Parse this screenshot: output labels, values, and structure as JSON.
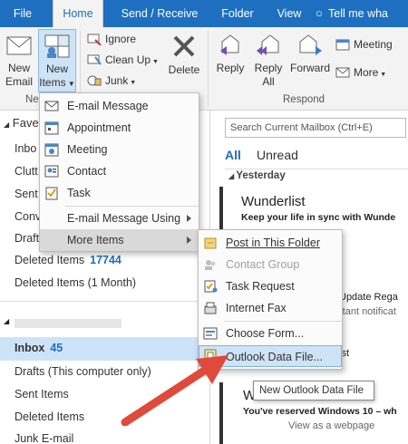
{
  "tabs": [
    "File",
    "Home",
    "Send / Receive",
    "Folder",
    "View",
    "Tell me wha"
  ],
  "ribbon": {
    "new_email": [
      "New",
      "Email"
    ],
    "new_items": [
      "New",
      "Items"
    ],
    "group_new_label": "Ne",
    "ignore": "Ignore",
    "clean_up": "Clean Up",
    "junk": "Junk",
    "delete": "Delete",
    "reply": "Reply",
    "reply_all": [
      "Reply",
      "All"
    ],
    "forward": "Forward",
    "meeting": "Meeting",
    "more": "More",
    "group_respond_label": "Respond"
  },
  "nav": {
    "favorites_header": "Fave",
    "fav_items": [
      "Inbo",
      "Clutt",
      "Sent",
      "Conv",
      "Draft"
    ],
    "deleted_items": "Deleted Items",
    "deleted_count": "17744",
    "deleted_one_month": "Deleted Items (1 Month)",
    "inbox": "Inbox",
    "inbox_count": "45",
    "drafts": "Drafts (This computer only)",
    "sent_items": "Sent Items",
    "deleted_items2": "Deleted Items",
    "junk": "Junk E-mail"
  },
  "main": {
    "search_placeholder": "Search Current Mailbox (Ctrl+E)",
    "filter_all": "All",
    "filter_unread": "Unread",
    "group_yesterday": "Yesterday",
    "msg1_sender": "Wunderlist",
    "msg1_subject": "Keep your life in sync with Wunde",
    "frag1": "Update Rega",
    "frag2": "rtant notificat",
    "frag3": "ist",
    "msg2_sender": "W",
    "msg2_subject": "You've reserved Windows 10 – wh",
    "view_web": "View as a webpage"
  },
  "menu1": {
    "items": [
      "E-mail Message",
      "Appointment",
      "Meeting",
      "Contact",
      "Task",
      "E-mail Message Using",
      "More Items"
    ]
  },
  "menu2": {
    "items": [
      "Post in This Folder",
      "Contact Group",
      "Task Request",
      "Internet Fax",
      "Choose Form...",
      "Outlook Data File..."
    ]
  },
  "tooltip": "New Outlook Data File",
  "colors": {
    "accent": "#1e6fc0",
    "arrow": "#e04a3a",
    "highlight": "#cfe3f7"
  }
}
